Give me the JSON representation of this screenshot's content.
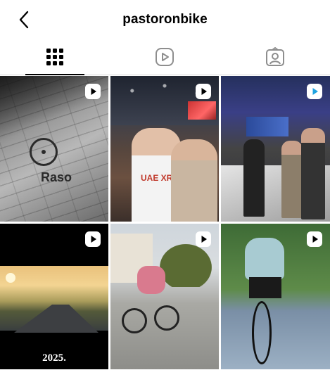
{
  "header": {
    "title": "pastoronbike",
    "back_icon": "chevron-left-icon"
  },
  "tabs": [
    {
      "name": "posts",
      "icon": "grid-icon",
      "active": true
    },
    {
      "name": "reels",
      "icon": "reels-icon",
      "active": false
    },
    {
      "name": "tagged",
      "icon": "tagged-icon",
      "active": false
    }
  ],
  "grid": {
    "items": [
      {
        "type": "reel",
        "badge_icon": "reel-icon",
        "overlay_text": "Raso"
      },
      {
        "type": "reel",
        "badge_icon": "reel-icon",
        "overlay_text": "UAE XRG"
      },
      {
        "type": "reel",
        "badge_icon": "reel-blue-icon",
        "overlay_text": ""
      },
      {
        "type": "reel",
        "badge_icon": "reel-icon",
        "overlay_text": "2025."
      },
      {
        "type": "reel",
        "badge_icon": "reel-icon",
        "overlay_text": ""
      },
      {
        "type": "reel",
        "badge_icon": "reel-icon",
        "overlay_text": ""
      }
    ]
  },
  "colors": {
    "text": "#000000",
    "divider": "#dbdbdb",
    "icon_gray": "#8e8e8e",
    "active_indicator": "#000000"
  }
}
